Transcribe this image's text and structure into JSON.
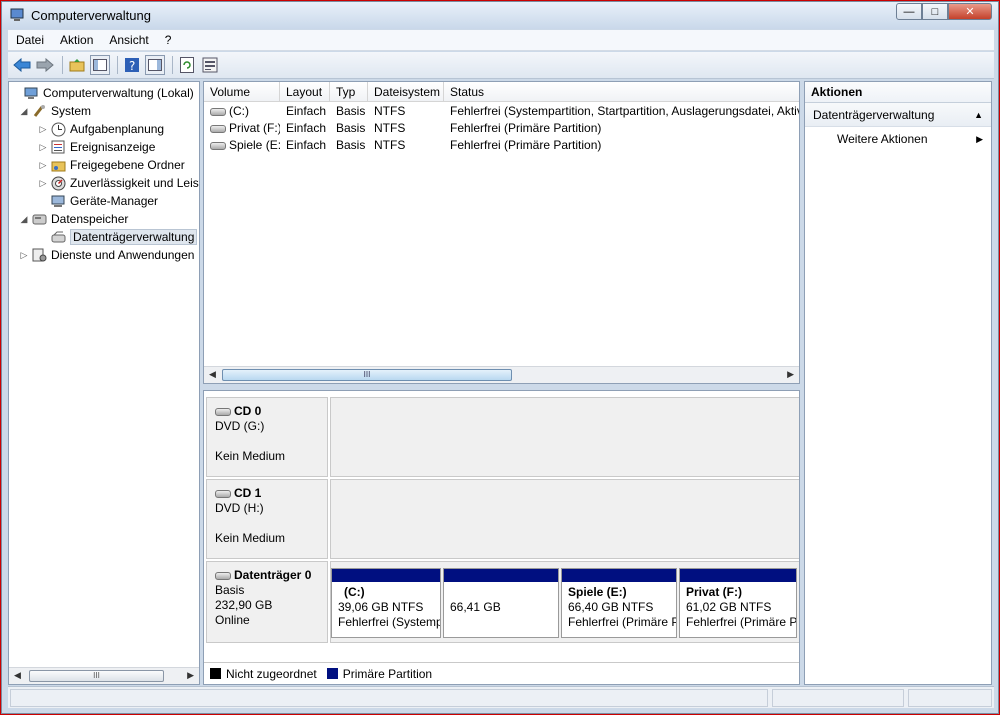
{
  "window": {
    "title": "Computerverwaltung"
  },
  "menu": [
    "Datei",
    "Aktion",
    "Ansicht",
    "?"
  ],
  "tree": {
    "items": [
      {
        "label": "Computerverwaltung (Lokal)",
        "icon": "computer-icon"
      },
      {
        "label": "System",
        "icon": "tools-icon"
      },
      {
        "label": "Aufgabenplanung",
        "icon": "clock-icon"
      },
      {
        "label": "Ereignisanzeige",
        "icon": "event-viewer-icon"
      },
      {
        "label": "Freigegebene Ordner",
        "icon": "shared-folder-icon"
      },
      {
        "label": "Zuverlässigkeit und Leistung",
        "icon": "performance-icon"
      },
      {
        "label": "Geräte-Manager",
        "icon": "device-manager-icon"
      },
      {
        "label": "Datenspeicher",
        "icon": "storage-icon"
      },
      {
        "label": "Datenträgerverwaltung",
        "icon": "disk-management-icon"
      },
      {
        "label": "Dienste und Anwendungen",
        "icon": "services-icon"
      }
    ]
  },
  "volumes": {
    "columns": [
      "Volume",
      "Layout",
      "Typ",
      "Dateisystem",
      "Status"
    ],
    "rows": [
      [
        "(C:)",
        "Einfach",
        "Basis",
        "NTFS",
        "Fehlerfrei (Systempartition, Startpartition, Auslagerungsdatei, Aktiv"
      ],
      [
        "Privat (F:)",
        "Einfach",
        "Basis",
        "NTFS",
        "Fehlerfrei (Primäre Partition)"
      ],
      [
        "Spiele (E:)",
        "Einfach",
        "Basis",
        "NTFS",
        "Fehlerfrei (Primäre Partition)"
      ]
    ],
    "scroll_thumb": "III"
  },
  "disks": {
    "cd0": {
      "name": "CD 0",
      "drive": "DVD (G:)",
      "status": "Kein Medium"
    },
    "cd1": {
      "name": "CD 1",
      "drive": "DVD (H:)",
      "status": "Kein Medium"
    },
    "disk0": {
      "name": "Datenträger 0",
      "type": "Basis",
      "size": "232,90 GB",
      "state": "Online",
      "partitions": [
        {
          "name": "(C:)",
          "size": "39,06 GB NTFS",
          "status": "Fehlerfrei (Systempartition"
        },
        {
          "name": "",
          "size": "66,41 GB",
          "status": ""
        },
        {
          "name": "Spiele  (E:)",
          "size": "66,40 GB NTFS",
          "status": "Fehlerfrei (Primäre Partition"
        },
        {
          "name": "Privat  (F:)",
          "size": "61,02 GB NTFS",
          "status": "Fehlerfrei (Primäre Partition"
        }
      ]
    }
  },
  "legend": {
    "unallocated": "Nicht zugeordnet",
    "unallocated_color": "#000000",
    "primary": "Primäre Partition",
    "primary_color": "#000f80"
  },
  "actions": {
    "header": "Aktionen",
    "section": "Datenträgerverwaltung",
    "more": "Weitere Aktionen"
  },
  "tree_scroll_thumb": "III"
}
